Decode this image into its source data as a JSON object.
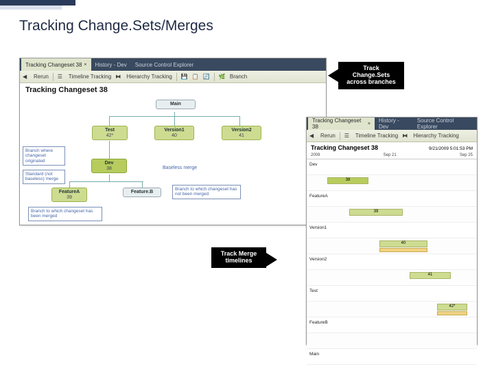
{
  "slide": {
    "title": "Tracking Change.Sets/Merges"
  },
  "panel1": {
    "tabs": [
      {
        "label": "Tracking Changeset 38"
      },
      {
        "label": "History - Dev"
      },
      {
        "label": "Source Control Explorer"
      }
    ],
    "toolbar": {
      "rerun": "Rerun",
      "timeline": "Timeline Tracking",
      "hierarchy": "Hierarchy Tracking",
      "branch": "Branch"
    },
    "title": "Tracking Changeset 38",
    "nodes": {
      "main": {
        "name": "Main",
        "val": ""
      },
      "test": {
        "name": "Test",
        "val": "42*"
      },
      "v1": {
        "name": "Version1",
        "val": "40"
      },
      "v2": {
        "name": "Version2",
        "val": "41"
      },
      "dev": {
        "name": "Dev",
        "val": "38"
      },
      "fa": {
        "name": "FeatureA",
        "val": "39"
      },
      "fb": {
        "name": "Feature.B",
        "val": ""
      }
    },
    "labels": {
      "baseless": "Baseless merge"
    },
    "callouts": {
      "origin": "Branch where changeset originated",
      "stdmerge": "Standard (not baseless) merge",
      "notmerged": "Branch to which changeset has not been merged",
      "merged": "Branch to which changeset has been merged"
    }
  },
  "panel2": {
    "tabs": [
      {
        "label": "Tracking Changeset 38"
      },
      {
        "label": "History - Dev"
      },
      {
        "label": "Source Control Explorer"
      }
    ],
    "toolbar": {
      "rerun": "Rerun",
      "timeline": "Timeline Tracking",
      "hierarchy": "Hierarchy Tracking"
    },
    "title": "Tracking Changeset 38",
    "daterange": {
      "year": "2009",
      "start": "Sep 21",
      "end": "Sep 25",
      "stamp": "9/21/2009 5:01:53 PM"
    },
    "rows": [
      {
        "label": "Dev",
        "bar": "38"
      },
      {
        "label": "FeatureA",
        "bar": "39"
      },
      {
        "label": "Version1",
        "bar": "40"
      },
      {
        "label": "Version2",
        "bar": "41"
      },
      {
        "label": "Test",
        "bar": "42*"
      },
      {
        "label": "FeatureB"
      },
      {
        "label": "Main"
      }
    ]
  },
  "annotations": {
    "a1": "Track Change.Sets across branches",
    "a2": "Track Merge timelines"
  }
}
